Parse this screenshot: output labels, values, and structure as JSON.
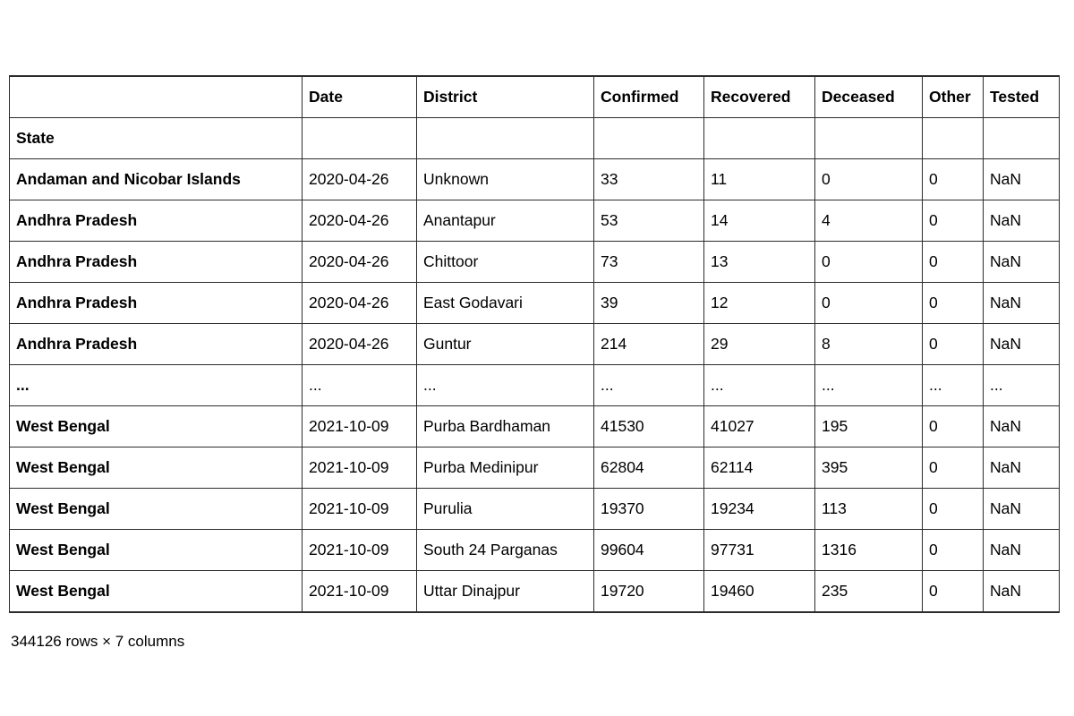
{
  "dataframe": {
    "index_name": "State",
    "columns": [
      "Date",
      "District",
      "Confirmed",
      "Recovered",
      "Deceased",
      "Other",
      "Tested"
    ],
    "corner_label": "",
    "ellipsis": "...",
    "rows": [
      {
        "index": "Andaman and Nicobar Islands",
        "cells": [
          "2020-04-26",
          "Unknown",
          "33",
          "11",
          "0",
          "0",
          "NaN"
        ]
      },
      {
        "index": "Andhra Pradesh",
        "cells": [
          "2020-04-26",
          "Anantapur",
          "53",
          "14",
          "4",
          "0",
          "NaN"
        ]
      },
      {
        "index": "Andhra Pradesh",
        "cells": [
          "2020-04-26",
          "Chittoor",
          "73",
          "13",
          "0",
          "0",
          "NaN"
        ]
      },
      {
        "index": "Andhra Pradesh",
        "cells": [
          "2020-04-26",
          "East Godavari",
          "39",
          "12",
          "0",
          "0",
          "NaN"
        ]
      },
      {
        "index": "Andhra Pradesh",
        "cells": [
          "2020-04-26",
          "Guntur",
          "214",
          "29",
          "8",
          "0",
          "NaN"
        ]
      },
      {
        "index": "...",
        "cells": [
          "...",
          "...",
          "...",
          "...",
          "...",
          "...",
          "..."
        ]
      },
      {
        "index": "West Bengal",
        "cells": [
          "2021-10-09",
          "Purba Bardhaman",
          "41530",
          "41027",
          "195",
          "0",
          "NaN"
        ]
      },
      {
        "index": "West Bengal",
        "cells": [
          "2021-10-09",
          "Purba Medinipur",
          "62804",
          "62114",
          "395",
          "0",
          "NaN"
        ]
      },
      {
        "index": "West Bengal",
        "cells": [
          "2021-10-09",
          "Purulia",
          "19370",
          "19234",
          "113",
          "0",
          "NaN"
        ]
      },
      {
        "index": "West Bengal",
        "cells": [
          "2021-10-09",
          "South 24 Parganas",
          "99604",
          "97731",
          "1316",
          "0",
          "NaN"
        ]
      },
      {
        "index": "West Bengal",
        "cells": [
          "2021-10-09",
          "Uttar Dinajpur",
          "19720",
          "19460",
          "235",
          "0",
          "NaN"
        ]
      }
    ],
    "shape_text": "344126 rows × 7 columns"
  }
}
